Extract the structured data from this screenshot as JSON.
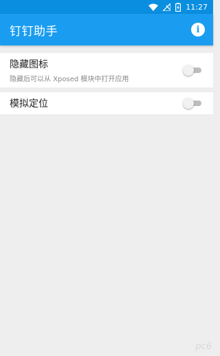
{
  "statusbar": {
    "time": "11:27",
    "icons": [
      "wifi-icon",
      "signal-off-icon",
      "battery-charging-icon"
    ]
  },
  "appbar": {
    "title": "钉钉助手",
    "action_icon": "info-icon",
    "accent_color": "#1a9df0"
  },
  "settings": {
    "hide_icon": {
      "title": "隐藏图标",
      "subtitle": "隐藏后可以从 Xposed 模块中打开应用",
      "enabled": false
    },
    "mock_location": {
      "title": "模拟定位",
      "enabled": false
    }
  },
  "watermark": "pc6"
}
